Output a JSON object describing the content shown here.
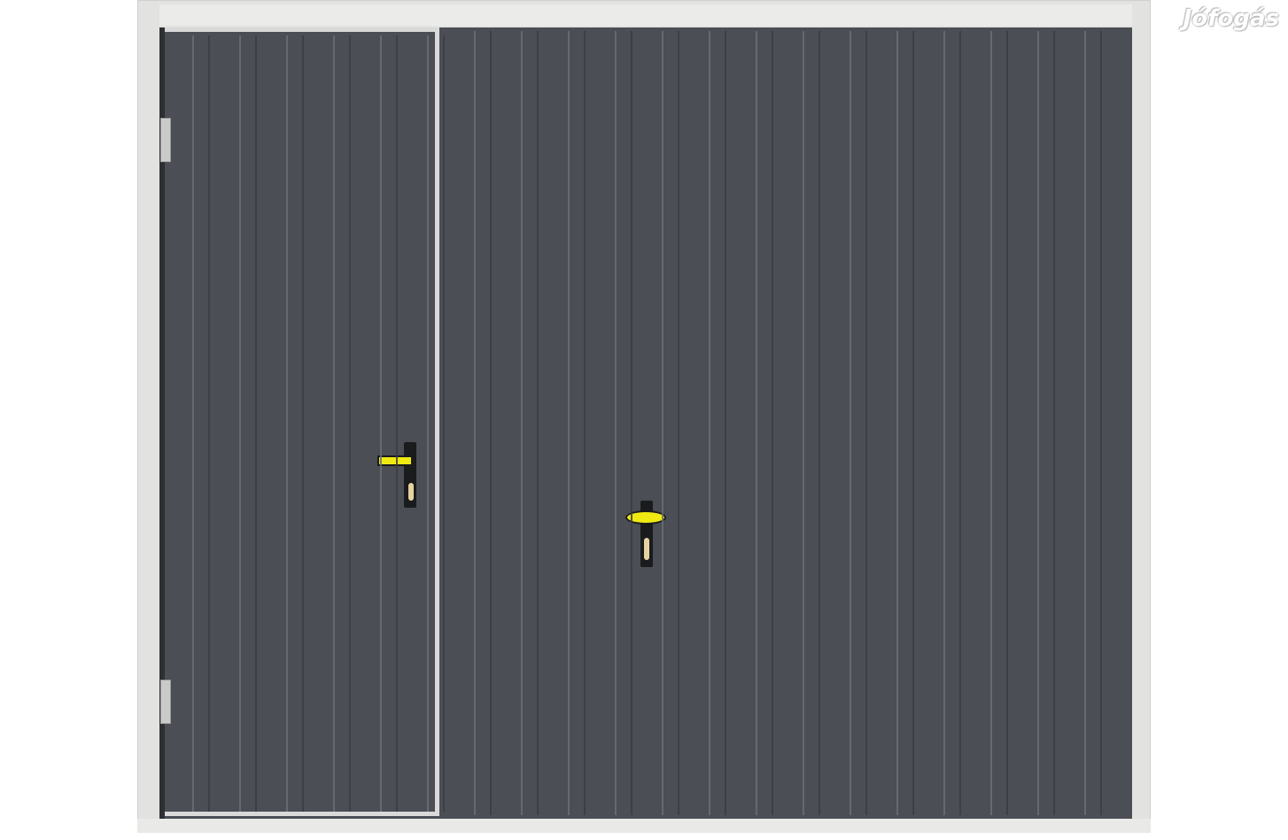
{
  "image": {
    "subject": "garage-door-with-wicket-door",
    "colors": {
      "panel": "#4b4e54",
      "frame": "#e2e3e1",
      "groove": "#6a6e76",
      "handle_lever": "#f0ea12",
      "handle_plate": "#1a1b1d"
    }
  },
  "watermark": {
    "text": "Jófogás"
  }
}
